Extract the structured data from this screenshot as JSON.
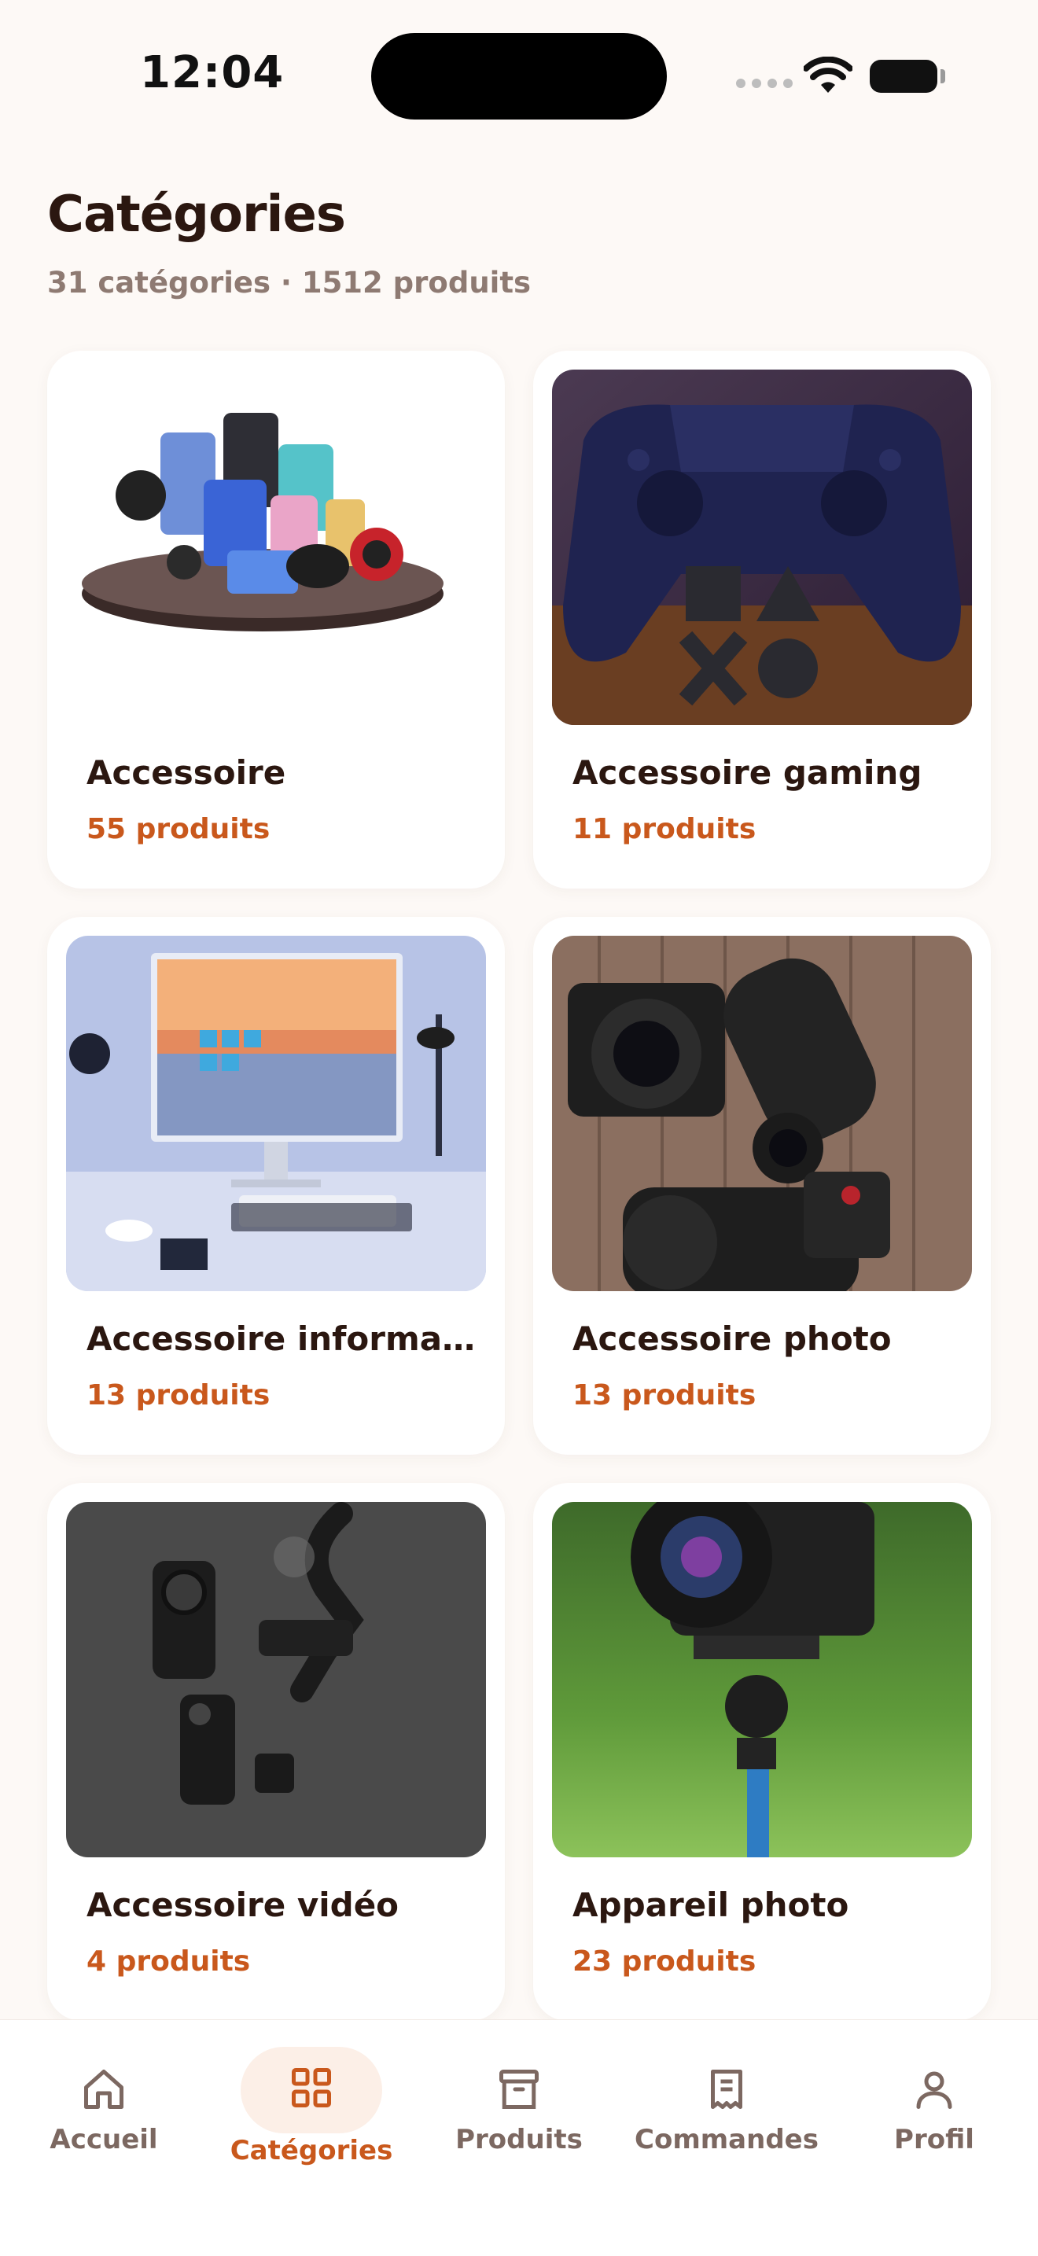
{
  "status_bar": {
    "time": "12:04"
  },
  "header": {
    "title": "Catégories",
    "subtitle": "31 catégories · 1512 produits"
  },
  "categories": [
    {
      "name": "Accessoire",
      "count": "55 produits",
      "image": "electronics-accessories-collage"
    },
    {
      "name": "Accessoire gaming",
      "count": "11 produits",
      "image": "gaming-controller"
    },
    {
      "name": "Accessoire informati...",
      "count": "13 produits",
      "image": "computer-desk-setup"
    },
    {
      "name": "Accessoire photo",
      "count": "13 produits",
      "image": "camera-lenses-on-wood"
    },
    {
      "name": "Accessoire vidéo",
      "count": "4 produits",
      "image": "phone-gimbal-kit"
    },
    {
      "name": "Appareil photo",
      "count": "23 produits",
      "image": "camera-on-tripod"
    }
  ],
  "tabbar": {
    "items": [
      {
        "label": "Accueil",
        "icon": "home-icon"
      },
      {
        "label": "Catégories",
        "icon": "grid-icon",
        "active": true
      },
      {
        "label": "Produits",
        "icon": "box-icon"
      },
      {
        "label": "Commandes",
        "icon": "receipt-icon"
      },
      {
        "label": "Profil",
        "icon": "user-icon"
      }
    ]
  },
  "colors": {
    "background": "#FDF9F6",
    "accent": "#C9581C",
    "title": "#2B1710",
    "muted": "#8E7A72"
  }
}
